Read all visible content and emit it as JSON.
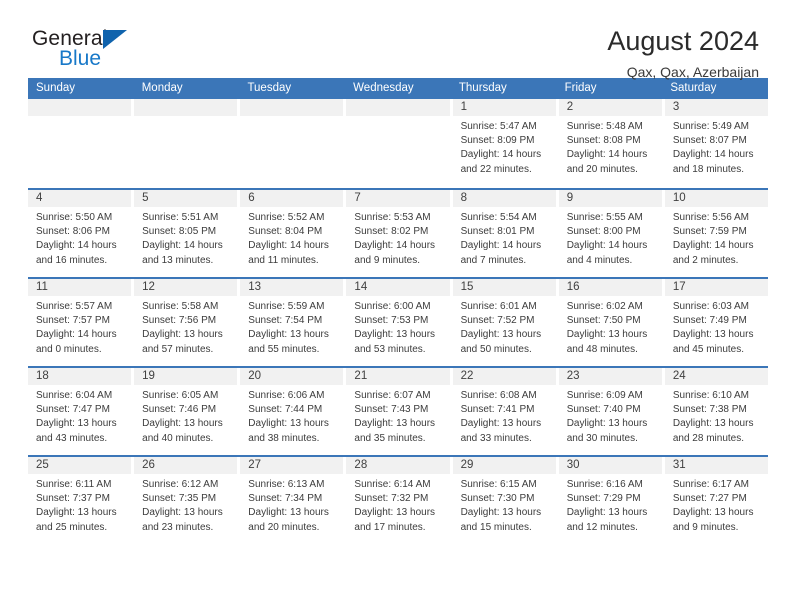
{
  "brand": {
    "line1": "General",
    "line2": "Blue",
    "triangle_color": "#1063ad",
    "blue_color": "#1878c8"
  },
  "header": {
    "title": "August 2024",
    "subtitle": "Qax, Qax, Azerbaijan"
  },
  "theme": {
    "header_blue": "#3b76b8",
    "day_band_gray": "#f1f1f1",
    "text_color": "#3c3c3c"
  },
  "weekdays": [
    "Sunday",
    "Monday",
    "Tuesday",
    "Wednesday",
    "Thursday",
    "Friday",
    "Saturday"
  ],
  "weeks": [
    [
      {
        "day": "",
        "sunrise": "",
        "sunset": "",
        "daylight1": "",
        "daylight2": ""
      },
      {
        "day": "",
        "sunrise": "",
        "sunset": "",
        "daylight1": "",
        "daylight2": ""
      },
      {
        "day": "",
        "sunrise": "",
        "sunset": "",
        "daylight1": "",
        "daylight2": ""
      },
      {
        "day": "",
        "sunrise": "",
        "sunset": "",
        "daylight1": "",
        "daylight2": ""
      },
      {
        "day": "1",
        "sunrise": "Sunrise: 5:47 AM",
        "sunset": "Sunset: 8:09 PM",
        "daylight1": "Daylight: 14 hours",
        "daylight2": "and 22 minutes."
      },
      {
        "day": "2",
        "sunrise": "Sunrise: 5:48 AM",
        "sunset": "Sunset: 8:08 PM",
        "daylight1": "Daylight: 14 hours",
        "daylight2": "and 20 minutes."
      },
      {
        "day": "3",
        "sunrise": "Sunrise: 5:49 AM",
        "sunset": "Sunset: 8:07 PM",
        "daylight1": "Daylight: 14 hours",
        "daylight2": "and 18 minutes."
      }
    ],
    [
      {
        "day": "4",
        "sunrise": "Sunrise: 5:50 AM",
        "sunset": "Sunset: 8:06 PM",
        "daylight1": "Daylight: 14 hours",
        "daylight2": "and 16 minutes."
      },
      {
        "day": "5",
        "sunrise": "Sunrise: 5:51 AM",
        "sunset": "Sunset: 8:05 PM",
        "daylight1": "Daylight: 14 hours",
        "daylight2": "and 13 minutes."
      },
      {
        "day": "6",
        "sunrise": "Sunrise: 5:52 AM",
        "sunset": "Sunset: 8:04 PM",
        "daylight1": "Daylight: 14 hours",
        "daylight2": "and 11 minutes."
      },
      {
        "day": "7",
        "sunrise": "Sunrise: 5:53 AM",
        "sunset": "Sunset: 8:02 PM",
        "daylight1": "Daylight: 14 hours",
        "daylight2": "and 9 minutes."
      },
      {
        "day": "8",
        "sunrise": "Sunrise: 5:54 AM",
        "sunset": "Sunset: 8:01 PM",
        "daylight1": "Daylight: 14 hours",
        "daylight2": "and 7 minutes."
      },
      {
        "day": "9",
        "sunrise": "Sunrise: 5:55 AM",
        "sunset": "Sunset: 8:00 PM",
        "daylight1": "Daylight: 14 hours",
        "daylight2": "and 4 minutes."
      },
      {
        "day": "10",
        "sunrise": "Sunrise: 5:56 AM",
        "sunset": "Sunset: 7:59 PM",
        "daylight1": "Daylight: 14 hours",
        "daylight2": "and 2 minutes."
      }
    ],
    [
      {
        "day": "11",
        "sunrise": "Sunrise: 5:57 AM",
        "sunset": "Sunset: 7:57 PM",
        "daylight1": "Daylight: 14 hours",
        "daylight2": "and 0 minutes."
      },
      {
        "day": "12",
        "sunrise": "Sunrise: 5:58 AM",
        "sunset": "Sunset: 7:56 PM",
        "daylight1": "Daylight: 13 hours",
        "daylight2": "and 57 minutes."
      },
      {
        "day": "13",
        "sunrise": "Sunrise: 5:59 AM",
        "sunset": "Sunset: 7:54 PM",
        "daylight1": "Daylight: 13 hours",
        "daylight2": "and 55 minutes."
      },
      {
        "day": "14",
        "sunrise": "Sunrise: 6:00 AM",
        "sunset": "Sunset: 7:53 PM",
        "daylight1": "Daylight: 13 hours",
        "daylight2": "and 53 minutes."
      },
      {
        "day": "15",
        "sunrise": "Sunrise: 6:01 AM",
        "sunset": "Sunset: 7:52 PM",
        "daylight1": "Daylight: 13 hours",
        "daylight2": "and 50 minutes."
      },
      {
        "day": "16",
        "sunrise": "Sunrise: 6:02 AM",
        "sunset": "Sunset: 7:50 PM",
        "daylight1": "Daylight: 13 hours",
        "daylight2": "and 48 minutes."
      },
      {
        "day": "17",
        "sunrise": "Sunrise: 6:03 AM",
        "sunset": "Sunset: 7:49 PM",
        "daylight1": "Daylight: 13 hours",
        "daylight2": "and 45 minutes."
      }
    ],
    [
      {
        "day": "18",
        "sunrise": "Sunrise: 6:04 AM",
        "sunset": "Sunset: 7:47 PM",
        "daylight1": "Daylight: 13 hours",
        "daylight2": "and 43 minutes."
      },
      {
        "day": "19",
        "sunrise": "Sunrise: 6:05 AM",
        "sunset": "Sunset: 7:46 PM",
        "daylight1": "Daylight: 13 hours",
        "daylight2": "and 40 minutes."
      },
      {
        "day": "20",
        "sunrise": "Sunrise: 6:06 AM",
        "sunset": "Sunset: 7:44 PM",
        "daylight1": "Daylight: 13 hours",
        "daylight2": "and 38 minutes."
      },
      {
        "day": "21",
        "sunrise": "Sunrise: 6:07 AM",
        "sunset": "Sunset: 7:43 PM",
        "daylight1": "Daylight: 13 hours",
        "daylight2": "and 35 minutes."
      },
      {
        "day": "22",
        "sunrise": "Sunrise: 6:08 AM",
        "sunset": "Sunset: 7:41 PM",
        "daylight1": "Daylight: 13 hours",
        "daylight2": "and 33 minutes."
      },
      {
        "day": "23",
        "sunrise": "Sunrise: 6:09 AM",
        "sunset": "Sunset: 7:40 PM",
        "daylight1": "Daylight: 13 hours",
        "daylight2": "and 30 minutes."
      },
      {
        "day": "24",
        "sunrise": "Sunrise: 6:10 AM",
        "sunset": "Sunset: 7:38 PM",
        "daylight1": "Daylight: 13 hours",
        "daylight2": "and 28 minutes."
      }
    ],
    [
      {
        "day": "25",
        "sunrise": "Sunrise: 6:11 AM",
        "sunset": "Sunset: 7:37 PM",
        "daylight1": "Daylight: 13 hours",
        "daylight2": "and 25 minutes."
      },
      {
        "day": "26",
        "sunrise": "Sunrise: 6:12 AM",
        "sunset": "Sunset: 7:35 PM",
        "daylight1": "Daylight: 13 hours",
        "daylight2": "and 23 minutes."
      },
      {
        "day": "27",
        "sunrise": "Sunrise: 6:13 AM",
        "sunset": "Sunset: 7:34 PM",
        "daylight1": "Daylight: 13 hours",
        "daylight2": "and 20 minutes."
      },
      {
        "day": "28",
        "sunrise": "Sunrise: 6:14 AM",
        "sunset": "Sunset: 7:32 PM",
        "daylight1": "Daylight: 13 hours",
        "daylight2": "and 17 minutes."
      },
      {
        "day": "29",
        "sunrise": "Sunrise: 6:15 AM",
        "sunset": "Sunset: 7:30 PM",
        "daylight1": "Daylight: 13 hours",
        "daylight2": "and 15 minutes."
      },
      {
        "day": "30",
        "sunrise": "Sunrise: 6:16 AM",
        "sunset": "Sunset: 7:29 PM",
        "daylight1": "Daylight: 13 hours",
        "daylight2": "and 12 minutes."
      },
      {
        "day": "31",
        "sunrise": "Sunrise: 6:17 AM",
        "sunset": "Sunset: 7:27 PM",
        "daylight1": "Daylight: 13 hours",
        "daylight2": "and 9 minutes."
      }
    ]
  ]
}
